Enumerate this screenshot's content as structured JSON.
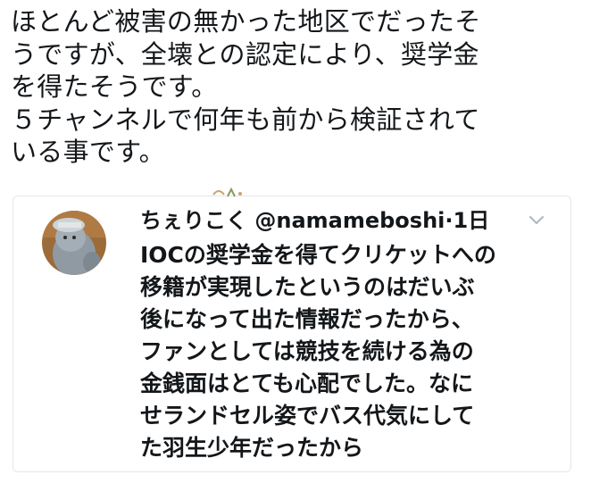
{
  "tweet": {
    "lines": [
      "ほとんど被害の無かった地区でだったそ",
      "うですが、全壊との認定により、奨学金",
      "を得たそうです。",
      "５チャンネルで何年も前から検証されて",
      "いる事です。"
    ]
  },
  "quoted_tweet": {
    "display_name": "ちぇりこく",
    "handle": "@namameboshi",
    "separator": "·",
    "time": "1日",
    "icons": {
      "menu": "chevron-down-icon",
      "avatar": "avatar"
    },
    "colors": {
      "text": "#14171a",
      "border": "#e1e8ed",
      "chevron": "#aab8c2"
    },
    "body_lines": [
      "IOCの奨学金を得てクリケットへの",
      "移籍が実現したというのはだいぶ",
      "後になって出た情報だったから、",
      "ファンとしては競技を続ける為の",
      "金銭面はとても心配でした。なに",
      "せランドセル姿でバス代気にして",
      "た羽生少年だったから"
    ]
  }
}
